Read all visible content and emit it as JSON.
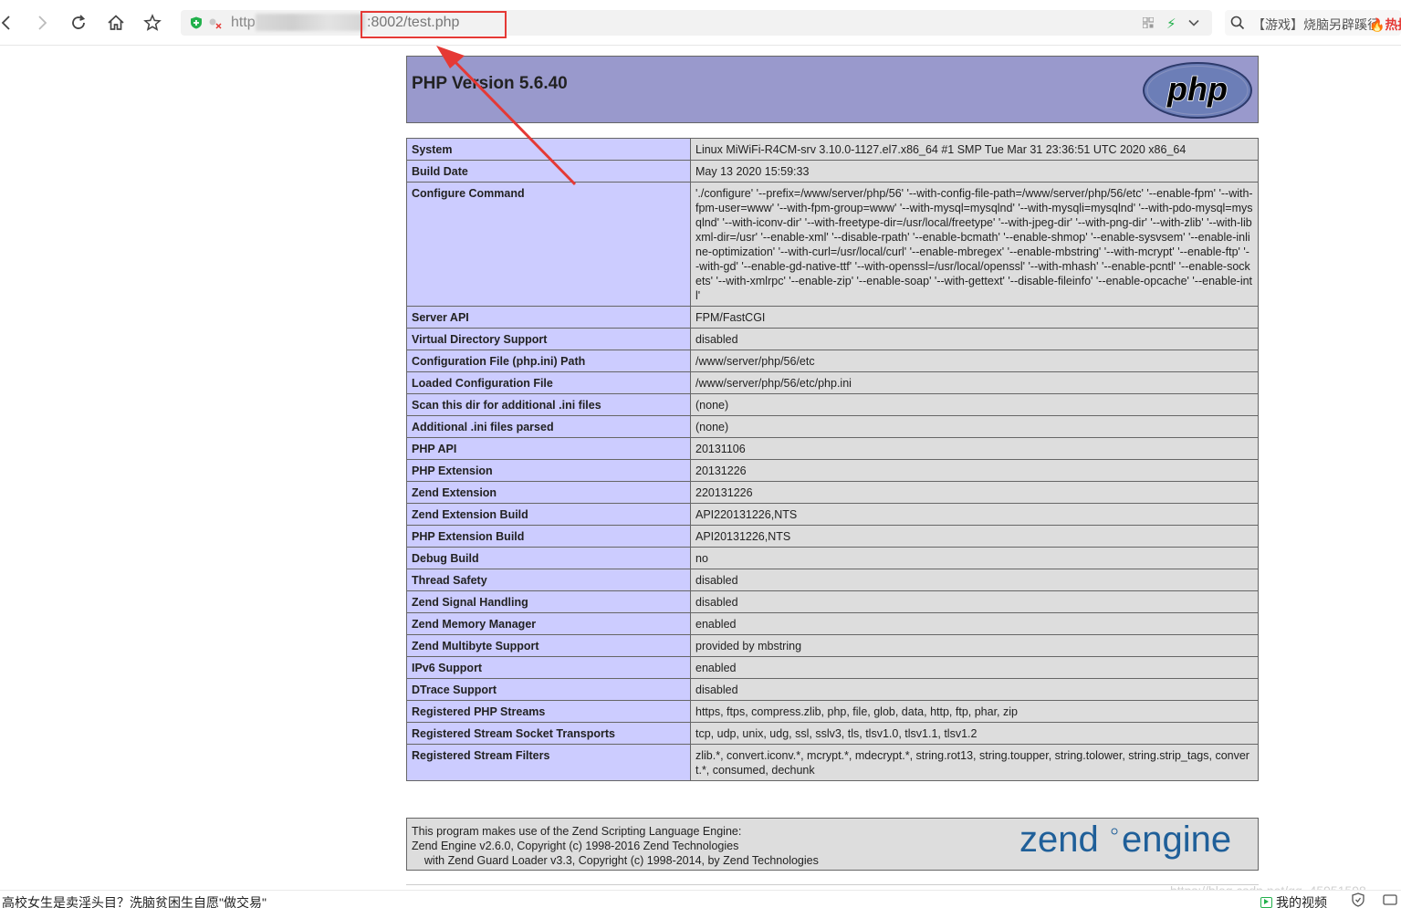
{
  "browser": {
    "url_prefix": "http",
    "url_path": ":8002/test.php",
    "search_text": "【游戏】烧脑另辟蹊径",
    "hot_label": "热搜"
  },
  "phpinfo": {
    "title": "PHP Version 5.6.40",
    "logo_text": "php",
    "rows": [
      {
        "key": "System",
        "value": "Linux MiWiFi-R4CM-srv 3.10.0-1127.el7.x86_64 #1 SMP Tue Mar 31 23:36:51 UTC 2020 x86_64"
      },
      {
        "key": "Build Date",
        "value": "May 13 2020 15:59:33"
      },
      {
        "key": "Configure Command",
        "value": "'./configure' '--prefix=/www/server/php/56' '--with-config-file-path=/www/server/php/56/etc' '--enable-fpm' '--with-fpm-user=www' '--with-fpm-group=www' '--with-mysql=mysqlnd' '--with-mysqli=mysqlnd' '--with-pdo-mysql=mysqlnd' '--with-iconv-dir' '--with-freetype-dir=/usr/local/freetype' '--with-jpeg-dir' '--with-png-dir' '--with-zlib' '--with-libxml-dir=/usr' '--enable-xml' '--disable-rpath' '--enable-bcmath' '--enable-shmop' '--enable-sysvsem' '--enable-inline-optimization' '--with-curl=/usr/local/curl' '--enable-mbregex' '--enable-mbstring' '--with-mcrypt' '--enable-ftp' '--with-gd' '--enable-gd-native-ttf' '--with-openssl=/usr/local/openssl' '--with-mhash' '--enable-pcntl' '--enable-sockets' '--with-xmlrpc' '--enable-zip' '--enable-soap' '--with-gettext' '--disable-fileinfo' '--enable-opcache' '--enable-intl'"
      },
      {
        "key": "Server API",
        "value": "FPM/FastCGI"
      },
      {
        "key": "Virtual Directory Support",
        "value": "disabled"
      },
      {
        "key": "Configuration File (php.ini) Path",
        "value": "/www/server/php/56/etc"
      },
      {
        "key": "Loaded Configuration File",
        "value": "/www/server/php/56/etc/php.ini"
      },
      {
        "key": "Scan this dir for additional .ini files",
        "value": "(none)"
      },
      {
        "key": "Additional .ini files parsed",
        "value": "(none)"
      },
      {
        "key": "PHP API",
        "value": "20131106"
      },
      {
        "key": "PHP Extension",
        "value": "20131226"
      },
      {
        "key": "Zend Extension",
        "value": "220131226"
      },
      {
        "key": "Zend Extension Build",
        "value": "API220131226,NTS"
      },
      {
        "key": "PHP Extension Build",
        "value": "API20131226,NTS"
      },
      {
        "key": "Debug Build",
        "value": "no"
      },
      {
        "key": "Thread Safety",
        "value": "disabled"
      },
      {
        "key": "Zend Signal Handling",
        "value": "disabled"
      },
      {
        "key": "Zend Memory Manager",
        "value": "enabled"
      },
      {
        "key": "Zend Multibyte Support",
        "value": "provided by mbstring"
      },
      {
        "key": "IPv6 Support",
        "value": "enabled"
      },
      {
        "key": "DTrace Support",
        "value": "disabled"
      },
      {
        "key": "Registered PHP Streams",
        "value": "https, ftps, compress.zlib, php, file, glob, data, http, ftp, phar, zip"
      },
      {
        "key": "Registered Stream Socket Transports",
        "value": "tcp, udp, unix, udg, ssl, sslv3, tls, tlsv1.0, tlsv1.1, tlsv1.2"
      },
      {
        "key": "Registered Stream Filters",
        "value": "zlib.*, convert.iconv.*, mcrypt.*, mdecrypt.*, string.rot13, string.toupper, string.tolower, string.strip_tags, convert.*, consumed, dechunk"
      }
    ],
    "zend_text": "This program makes use of the Zend Scripting Language Engine:\nZend Engine v2.6.0, Copyright (c) 1998-2016 Zend Technologies\n    with Zend Guard Loader v3.3, Copyright (c) 1998-2014, by Zend Technologies",
    "zend_logo_word1": "zend",
    "zend_logo_word2": "engine"
  },
  "status_bar": {
    "news": "高校女生是卖淫头目？洗脑贫困生自愿\"做交易\"",
    "my_video": "我的视频"
  },
  "watermark": "https://blog.csdn.net/qq_45951598",
  "colors": {
    "header_bg": "#9999cc",
    "key_bg": "#ccccff",
    "value_bg": "#dddddd",
    "annotation_red": "#e53935",
    "zend_blue": "#1f5f99"
  }
}
